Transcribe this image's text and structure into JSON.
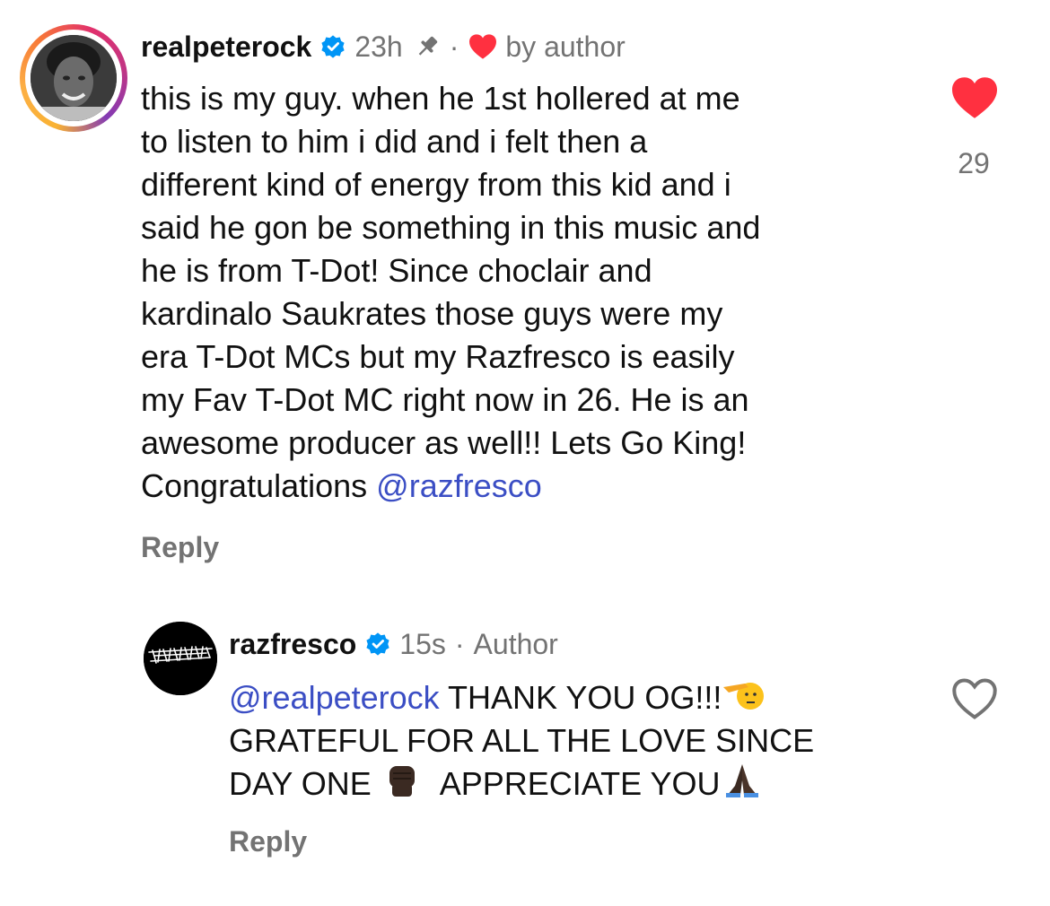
{
  "comment": {
    "username": "realpeterock",
    "time": "23h",
    "sep": "·",
    "by_author": "by author",
    "text_before_mention": "this is my guy. when he 1st hollered at me\nto listen to him i did and i felt then a\ndifferent kind of energy from this kid and i\nsaid he gon be something in this music and\nhe is from T-Dot! Since choclair and\nkardinalo Saukrates those guys were my\nera T-Dot MCs but my Razfresco is easily\nmy Fav T-Dot MC right now in 26. He is an\nawesome producer as well!! Lets Go King!\nCongratulations ",
    "mention": "@razfresco",
    "likes": "29",
    "reply_label": "Reply",
    "liked": true,
    "pinned": true,
    "verified": true
  },
  "reply": {
    "username": "razfresco",
    "time": "15s",
    "sep": "·",
    "author_badge": "Author",
    "mention": "@realpeterock",
    "text_part1": " THANK YOU OG!!!",
    "text_part2": "\nGRATEFUL FOR ALL THE LOVE SINCE\nDAY ONE ",
    "text_part3": "  APPRECIATE YOU",
    "emojis": [
      "saluting-face-emoji",
      "raised-fist-emoji",
      "folded-hands-emoji"
    ],
    "reply_label": "Reply",
    "liked": false,
    "verified": true
  },
  "colors": {
    "accent_link": "#3b4ec4",
    "like_red": "#ff3040",
    "verified_blue": "#0095f6",
    "muted_text": "#737373"
  }
}
